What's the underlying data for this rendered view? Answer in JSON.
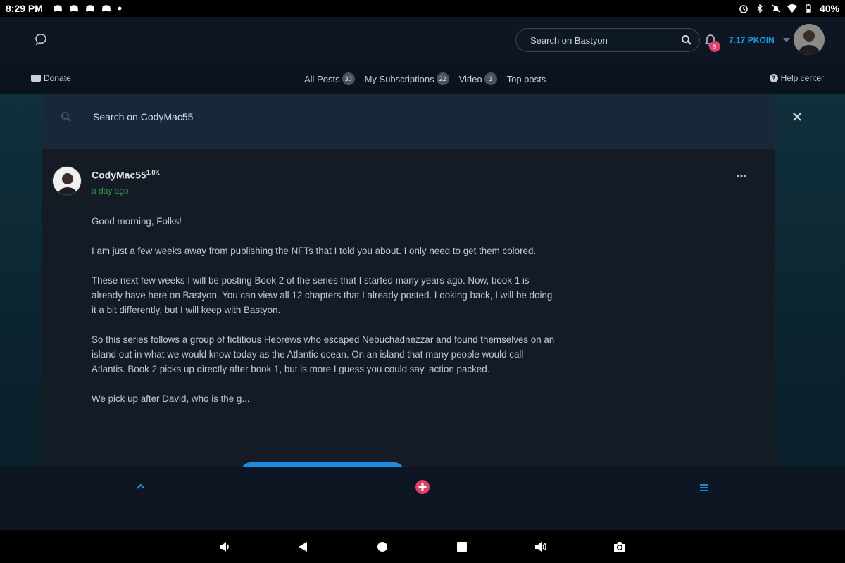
{
  "status_bar": {
    "time": "8:29 PM",
    "battery": "40%"
  },
  "header": {
    "search_placeholder": "Search on Bastyon",
    "notification_count": "9",
    "balance": "7.17 PKOIN"
  },
  "nav": {
    "donate_label": "Donate",
    "tabs": [
      {
        "label": "All Posts",
        "count": "30"
      },
      {
        "label": "My Subscriptions",
        "count": "22"
      },
      {
        "label": "Video",
        "count": "3"
      },
      {
        "label": "Top posts",
        "count": ""
      }
    ],
    "help_label": "Help center"
  },
  "profile_search": {
    "placeholder": "Search on CodyMac55"
  },
  "post": {
    "author": "CodyMac55",
    "reputation": "1.8K",
    "time_ago": "a day ago",
    "paragraphs": [
      "Good morning, Folks!",
      "I am just a few weeks away from publishing the NFTs that I told you about. I only need to get them colored.",
      "These next few weeks I will be posting Book 2 of the series that I started many years ago. Now, book 1 is already have here on Bastyon. You can view all 12 chapters that I already posted. Looking back, I will be doing it a bit differently, but I will keep with Bastyon.",
      "So this series follows a group of fictitious Hebrews who escaped Nebuchadnezzar and found themselves on an island out in what we would know today as the Atlantic ocean. On an island that many people would call Atlantis. Book 2 picks up directly after book 1, but is more I guess you could say, action packed.",
      "We pick up after David, who is the g..."
    ]
  },
  "colors": {
    "accent_blue": "#1e9be8",
    "add_pink": "#e0406b",
    "time_green": "#2f9a52"
  }
}
